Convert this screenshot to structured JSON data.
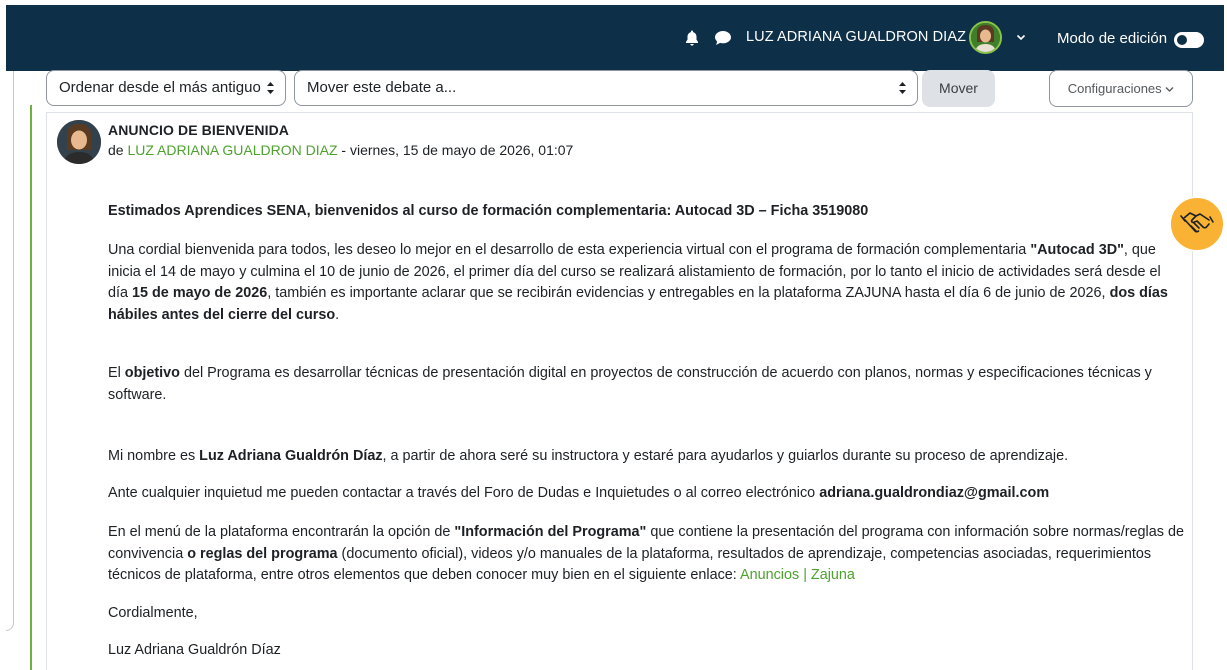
{
  "header": {
    "user_name": "LUZ ADRIANA GUALDRON DIAZ",
    "edit_mode_label": "Modo de edición",
    "icons": [
      "bell-icon",
      "chat-icon",
      "chevron-down-icon"
    ]
  },
  "toolbar": {
    "sort_select": "Ordenar desde el más antiguo",
    "move_select": "Mover este debate a...",
    "move_button": "Mover",
    "settings_button": "Configuraciones"
  },
  "post": {
    "title": "ANUNCIO DE BIENVENIDA",
    "meta_prefix": "de",
    "author": "LUZ ADRIANA GUALDRON DIAZ",
    "meta_date": "- viernes, 15 de mayo de 2026, 01:07",
    "heading": "Estimados Aprendices SENA, bienvenidos al curso de formación complementaria: Autocad 3D – Ficha 3519080",
    "p1": {
      "a": "Una cordial bienvenida para todos, les deseo lo mejor en el desarrollo de esta experiencia virtual con el programa de formación complementaria ",
      "b": "\"Autocad 3D\"",
      "c": ", que inicia el 14 de mayo y culmina el 10 de junio de 2026,  el primer día del curso se realizará alistamiento de formación, por lo tanto el inicio de actividades será desde el día ",
      "d": "15 de mayo de 2026",
      "e": ", también es importante aclarar que se recibirán evidencias y entregables en la plataforma ZAJUNA hasta el día 6 de junio de 2026, ",
      "f": "dos días hábiles antes del cierre del curso",
      "g": "."
    },
    "p2": {
      "a": "El ",
      "b": "objetivo",
      "c": " del Programa es desarrollar técnicas de presentación digital en proyectos de construcción de acuerdo con planos, normas y especificaciones técnicas y software."
    },
    "p3": {
      "a": "Mi nombre es ",
      "b": "Luz Adriana Gualdrón Díaz",
      "c": ", a partir de ahora seré su instructora y estaré para ayudarlos y guiarlos durante su proceso de aprendizaje."
    },
    "p4": {
      "a": "Ante cualquier inquietud me pueden contactar a través del Foro de Dudas e Inquietudes o al correo electrónico ",
      "b": "adriana.gualdrondiaz@gmail.com"
    },
    "p5": {
      "a": "En el menú de la plataforma encontrarán la opción de ",
      "b": "\"Información del Programa\"",
      "c": " que contiene la presentación del programa con información sobre normas/reglas de convivencia ",
      "d": "o reglas del programa",
      "e": " (documento oficial), videos y/o manuales de la plataforma, resultados de aprendizaje, competencias asociadas, requerimientos técnicos de plataforma, entre otros elementos que deben conocer muy bien en el siguiente enlace: ",
      "link": "Anuncios | Zajuna"
    },
    "closing": "Cordialmente,",
    "signature": "Luz Adriana Gualdrón Díaz"
  },
  "colors": {
    "navbar": "#0e2f48",
    "link_green": "#4ca22d",
    "floating_button": "#f9b233"
  },
  "floating_button_icon": "handshake-icon"
}
